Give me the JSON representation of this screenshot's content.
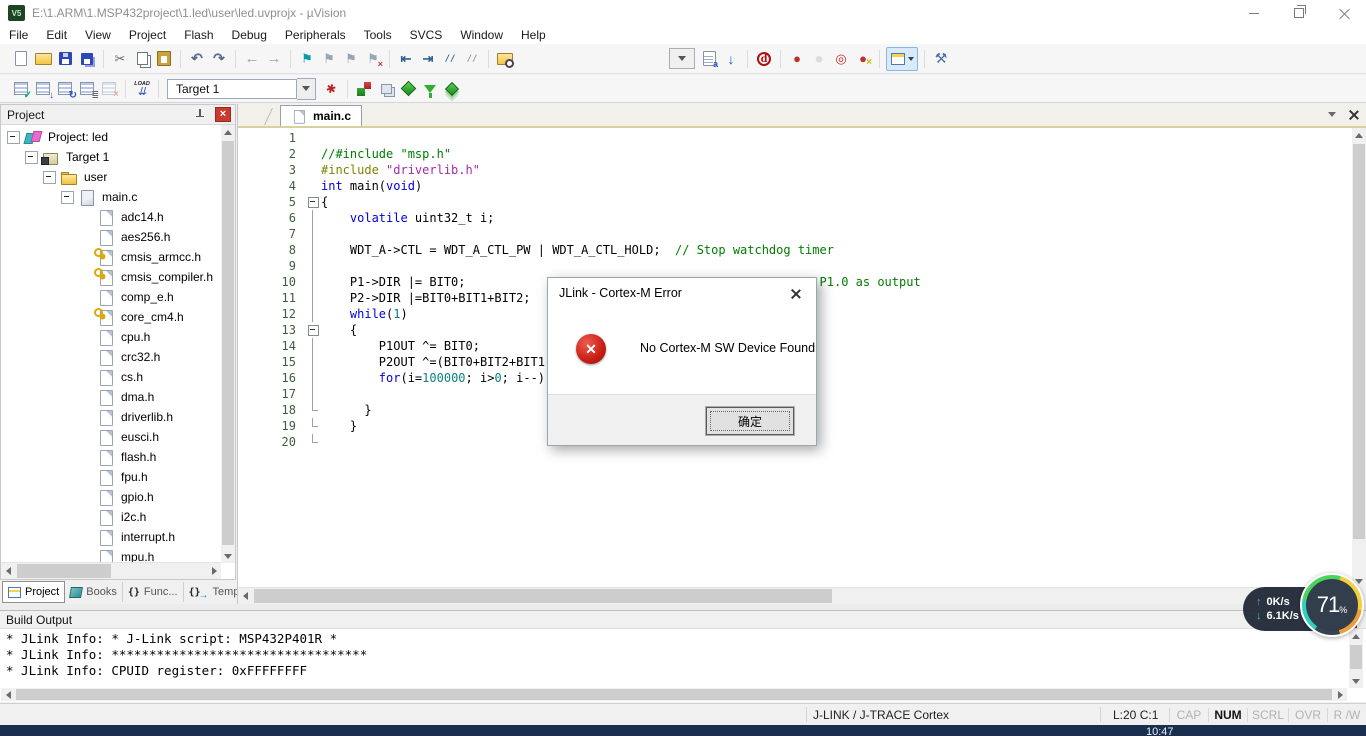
{
  "window": {
    "title": "E:\\1.ARM\\1.MSP432project\\1.led\\user\\led.uvprojx - µVision"
  },
  "menu": {
    "items": [
      "File",
      "Edit",
      "View",
      "Project",
      "Flash",
      "Debug",
      "Peripherals",
      "Tools",
      "SVCS",
      "Window",
      "Help"
    ]
  },
  "toolbar1": {
    "items": [
      {
        "n": "new-file-icon",
        "k": "g-new",
        "i": "true"
      },
      {
        "n": "open-file-icon",
        "k": "g-open",
        "i": "true"
      },
      {
        "n": "save-icon",
        "k": "g-save",
        "i": "true"
      },
      {
        "n": "save-all-icon",
        "k": "g-saveall",
        "i": "true"
      },
      {
        "n": "toolbar-separator",
        "k": "tsep",
        "i": "false"
      },
      {
        "n": "cut-icon",
        "k": "g-cut",
        "i": "true"
      },
      {
        "n": "copy-icon",
        "k": "g-copy",
        "i": "true"
      },
      {
        "n": "paste-icon",
        "k": "g-paste",
        "i": "true"
      },
      {
        "n": "toolbar-separator",
        "k": "tsep",
        "i": "false"
      },
      {
        "n": "undo-icon",
        "k": "g-undo",
        "i": "true"
      },
      {
        "n": "redo-icon",
        "k": "g-redo",
        "i": "true"
      },
      {
        "n": "toolbar-separator",
        "k": "tsep",
        "i": "false"
      },
      {
        "n": "navigate-back-icon",
        "k": "g-back",
        "i": "true"
      },
      {
        "n": "navigate-forward-icon",
        "k": "g-fwd",
        "i": "true"
      },
      {
        "n": "toolbar-separator",
        "k": "tsep",
        "i": "false"
      },
      {
        "n": "bookmark-icon",
        "k": "g-flag",
        "i": "true"
      },
      {
        "n": "bookmark-next-icon",
        "k": "g-flagn",
        "i": "true"
      },
      {
        "n": "bookmark-prev-icon",
        "k": "g-flagp",
        "i": "true"
      },
      {
        "n": "bookmark-clear-icon",
        "k": "g-flagx",
        "i": "true"
      },
      {
        "n": "toolbar-separator",
        "k": "tsep",
        "i": "false"
      },
      {
        "n": "unindent-icon",
        "k": "g-indl",
        "i": "true"
      },
      {
        "n": "indent-icon",
        "k": "g-indr",
        "i": "true"
      },
      {
        "n": "comment-icon",
        "k": "g-cmt",
        "i": "true"
      },
      {
        "n": "uncomment-icon",
        "k": "g-ucmt",
        "i": "true"
      },
      {
        "n": "toolbar-separator",
        "k": "tsep",
        "i": "false"
      },
      {
        "n": "find-in-files-icon",
        "k": "g-fif",
        "i": "true"
      },
      {
        "n": "toolbar-spacer",
        "k": "tgap",
        "i": "false"
      },
      {
        "n": "find-dropdown",
        "k": "combo1",
        "i": "true"
      },
      {
        "n": "find-in-document-icon",
        "k": "g-findtxt",
        "i": "true"
      },
      {
        "n": "incremental-find-icon",
        "k": "g-ifind",
        "i": "true"
      },
      {
        "n": "toolbar-separator",
        "k": "tsep",
        "i": "false"
      },
      {
        "n": "start-debug-icon",
        "k": "g-dbg",
        "i": "true"
      },
      {
        "n": "toolbar-separator",
        "k": "tsep",
        "i": "false"
      },
      {
        "n": "breakpoint-icon",
        "k": "g-bp",
        "i": "true"
      },
      {
        "n": "breakpoint-disable-icon",
        "k": "g-bpo",
        "i": "true"
      },
      {
        "n": "breakpoint-disable-all-icon",
        "k": "g-bpd",
        "i": "true"
      },
      {
        "n": "breakpoint-kill-all-icon",
        "k": "g-bpk",
        "i": "true"
      },
      {
        "n": "toolbar-separator",
        "k": "tsep",
        "i": "false"
      },
      {
        "n": "windows-list-button",
        "k": "g-winbtn",
        "i": "true"
      },
      {
        "n": "toolbar-separator",
        "k": "tsep",
        "i": "false"
      },
      {
        "n": "configure-icon",
        "k": "g-wrench",
        "i": "true"
      }
    ]
  },
  "toolbar2": {
    "items_left": [
      {
        "n": "translate-icon",
        "k": "g-btr",
        "i": "true"
      },
      {
        "n": "build-icon",
        "k": "g-bbl",
        "i": "true"
      },
      {
        "n": "rebuild-icon",
        "k": "g-brb",
        "i": "true"
      },
      {
        "n": "batch-build-icon",
        "k": "g-bba",
        "i": "true"
      },
      {
        "n": "stop-build-icon",
        "k": "g-bst",
        "i": "false"
      },
      {
        "n": "toolbar-separator",
        "k": "tsep",
        "i": "false"
      }
    ],
    "load_label": "LOAD",
    "target_select": "Target 1",
    "items_right": [
      {
        "n": "target-options-icon",
        "k": "g-wand",
        "i": "true"
      },
      {
        "n": "toolbar-separator",
        "k": "tsep",
        "i": "false"
      },
      {
        "n": "manage-components-icon",
        "k": "g-cube",
        "i": "true"
      },
      {
        "n": "windows-stack-icon",
        "k": "g-wins",
        "i": "true"
      },
      {
        "n": "manage-rte-icon",
        "k": "g-rte",
        "i": "true"
      },
      {
        "n": "filter-project-items-icon",
        "k": "g-fun",
        "i": "true"
      },
      {
        "n": "software-packs-icon",
        "k": "g-packs",
        "i": "true"
      }
    ]
  },
  "project_panel": {
    "title": "Project",
    "tree": [
      {
        "lvl": "lv0",
        "expc": "",
        "ic": "t-proj",
        "label": "Project: led"
      },
      {
        "lvl": "lv1",
        "expc": "",
        "ic": "t-target",
        "label": "Target 1"
      },
      {
        "lvl": "lv2",
        "expc": "",
        "ic": "t-folder",
        "label": "user"
      },
      {
        "lvl": "lv3",
        "expc": "",
        "ic": "t-filec",
        "label": "main.c"
      },
      {
        "lvl": "lv4",
        "expc": "hid",
        "ic": "t-fileh",
        "label": "adc14.h"
      },
      {
        "lvl": "lv4",
        "expc": "hid",
        "ic": "t-fileh",
        "label": "aes256.h"
      },
      {
        "lvl": "lv4",
        "expc": "hid",
        "ic": "t-fileh t-key",
        "label": "cmsis_armcc.h"
      },
      {
        "lvl": "lv4",
        "expc": "hid",
        "ic": "t-fileh t-key",
        "label": "cmsis_compiler.h"
      },
      {
        "lvl": "lv4",
        "expc": "hid",
        "ic": "t-fileh",
        "label": "comp_e.h"
      },
      {
        "lvl": "lv4",
        "expc": "hid",
        "ic": "t-fileh t-key",
        "label": "core_cm4.h"
      },
      {
        "lvl": "lv4",
        "expc": "hid",
        "ic": "t-fileh",
        "label": "cpu.h"
      },
      {
        "lvl": "lv4",
        "expc": "hid",
        "ic": "t-fileh",
        "label": "crc32.h"
      },
      {
        "lvl": "lv4",
        "expc": "hid",
        "ic": "t-fileh",
        "label": "cs.h"
      },
      {
        "lvl": "lv4",
        "expc": "hid",
        "ic": "t-fileh",
        "label": "dma.h"
      },
      {
        "lvl": "lv4",
        "expc": "hid",
        "ic": "t-fileh",
        "label": "driverlib.h"
      },
      {
        "lvl": "lv4",
        "expc": "hid",
        "ic": "t-fileh",
        "label": "eusci.h"
      },
      {
        "lvl": "lv4",
        "expc": "hid",
        "ic": "t-fileh",
        "label": "flash.h"
      },
      {
        "lvl": "lv4",
        "expc": "hid",
        "ic": "t-fileh",
        "label": "fpu.h"
      },
      {
        "lvl": "lv4",
        "expc": "hid",
        "ic": "t-fileh",
        "label": "gpio.h"
      },
      {
        "lvl": "lv4",
        "expc": "hid",
        "ic": "t-fileh",
        "label": "i2c.h"
      },
      {
        "lvl": "lv4",
        "expc": "hid",
        "ic": "t-fileh",
        "label": "interrupt.h"
      },
      {
        "lvl": "lv4",
        "expc": "hid",
        "ic": "t-fileh",
        "label": "mpu.h"
      }
    ]
  },
  "panel_tabs": [
    {
      "n": "panel-tab-project",
      "label": "Project",
      "k": "active",
      "ic": "pt-proj"
    },
    {
      "n": "panel-tab-books",
      "label": "Books",
      "k": "",
      "ic": "pt-books"
    },
    {
      "n": "panel-tab-functions",
      "label": "Func...",
      "k": "",
      "ic": "pt-func"
    },
    {
      "n": "panel-tab-templates",
      "label": "Temp...",
      "k": "",
      "ic": "pt-temp"
    }
  ],
  "editor": {
    "tab": "main.c",
    "lines": [
      {
        "n": 1,
        "f": "",
        "s": []
      },
      {
        "n": 2,
        "f": "",
        "s": [
          {
            "t": "//#include \"msp.h\"",
            "c": "c"
          }
        ]
      },
      {
        "n": 3,
        "f": "",
        "s": [
          {
            "t": "#include ",
            "c": "d"
          },
          {
            "t": "\"driverlib.h\"",
            "c": "s"
          }
        ]
      },
      {
        "n": 4,
        "f": "",
        "s": [
          {
            "t": "int",
            "c": "k"
          },
          {
            "t": " main(",
            "c": ""
          },
          {
            "t": "void",
            "c": "k"
          },
          {
            "t": ")",
            "c": ""
          }
        ]
      },
      {
        "n": 5,
        "f": "fbox",
        "s": [
          {
            "t": "{",
            "c": ""
          }
        ]
      },
      {
        "n": 6,
        "f": "fln",
        "s": [
          {
            "t": "    ",
            "c": ""
          },
          {
            "t": "volatile",
            "c": "k"
          },
          {
            "t": " uint32_t i;",
            "c": ""
          }
        ]
      },
      {
        "n": 7,
        "f": "fln",
        "s": []
      },
      {
        "n": 8,
        "f": "fln",
        "s": [
          {
            "t": "    WDT_A->CTL = WDT_A_CTL_PW | WDT_A_CTL_HOLD;  ",
            "c": ""
          },
          {
            "t": "// Stop watchdog timer",
            "c": "c"
          }
        ]
      },
      {
        "n": 9,
        "f": "fln",
        "s": []
      },
      {
        "n": 10,
        "f": "fln",
        "s": [
          {
            "t": "    P1->DIR |= BIT0;",
            "c": ""
          },
          {
            "t": "                                              ",
            "c": ""
          },
          {
            "t": "// P1.0 as output",
            "c": "c"
          }
        ]
      },
      {
        "n": 11,
        "f": "fln",
        "s": [
          {
            "t": "    P2->DIR |=BIT0+BIT1+BIT2;",
            "c": ""
          }
        ]
      },
      {
        "n": 12,
        "f": "fln",
        "s": [
          {
            "t": "    ",
            "c": ""
          },
          {
            "t": "while",
            "c": "k"
          },
          {
            "t": "(",
            "c": ""
          },
          {
            "t": "1",
            "c": "n"
          },
          {
            "t": ")",
            "c": ""
          }
        ]
      },
      {
        "n": 13,
        "f": "fbox",
        "s": [
          {
            "t": "    {",
            "c": ""
          }
        ]
      },
      {
        "n": 14,
        "f": "fln",
        "s": [
          {
            "t": "        P1OUT ^= BIT0;",
            "c": ""
          }
        ]
      },
      {
        "n": 15,
        "f": "fln",
        "s": [
          {
            "t": "        P2OUT ^=(BIT0+BIT2+BIT1);",
            "c": ""
          }
        ]
      },
      {
        "n": 16,
        "f": "fln",
        "s": [
          {
            "t": "        ",
            "c": ""
          },
          {
            "t": "for",
            "c": "k"
          },
          {
            "t": "(i=",
            "c": ""
          },
          {
            "t": "100000",
            "c": "n"
          },
          {
            "t": "; i>",
            "c": ""
          },
          {
            "t": "0",
            "c": "n"
          },
          {
            "t": "; i--);",
            "c": ""
          }
        ]
      },
      {
        "n": 17,
        "f": "fln",
        "s": []
      },
      {
        "n": 18,
        "f": "fend",
        "s": [
          {
            "t": "      }",
            "c": ""
          }
        ]
      },
      {
        "n": 19,
        "f": "fend",
        "s": [
          {
            "t": "    }",
            "c": ""
          }
        ]
      },
      {
        "n": 20,
        "f": "fend",
        "s": []
      }
    ]
  },
  "dialog": {
    "title": "JLink - Cortex-M Error",
    "message": "No Cortex-M SW Device Found",
    "ok_label": "确定"
  },
  "build_output": {
    "title": "Build Output",
    "lines": [
      "* JLink Info: * J-Link script: MSP432P401R *",
      "* JLink Info: **********************************",
      "* JLink Info: CPUID register: 0xFFFFFFFF"
    ]
  },
  "status_bar": {
    "debugger": "J-LINK / J-TRACE Cortex",
    "position": "L:20 C:1",
    "flags": [
      {
        "label": "CAP",
        "k": ""
      },
      {
        "label": "NUM",
        "k": "on"
      },
      {
        "label": "SCRL",
        "k": ""
      },
      {
        "label": "OVR",
        "k": ""
      },
      {
        "label": "R /W",
        "k": ""
      }
    ]
  },
  "overlay": {
    "up": "0K/s",
    "down": "6.1K/s",
    "percent": "71",
    "unit": "%"
  },
  "taskbar": {
    "clock": "10:47"
  },
  "colors": {
    "error_red": "#c81e14",
    "panel_close_red": "#c83b2e",
    "taskbar_navy": "#1a2f4d",
    "keyword_blue": "#0000e0",
    "comment_green": "#007d00",
    "string_magenta": "#a52aa5",
    "number_teal": "#0d8080",
    "gauge_ring": [
      "#2fd0c0",
      "#49d45f",
      "#f2cf3e",
      "#ef9c3a"
    ],
    "tab_accent_tan": "#d9d0a0"
  }
}
